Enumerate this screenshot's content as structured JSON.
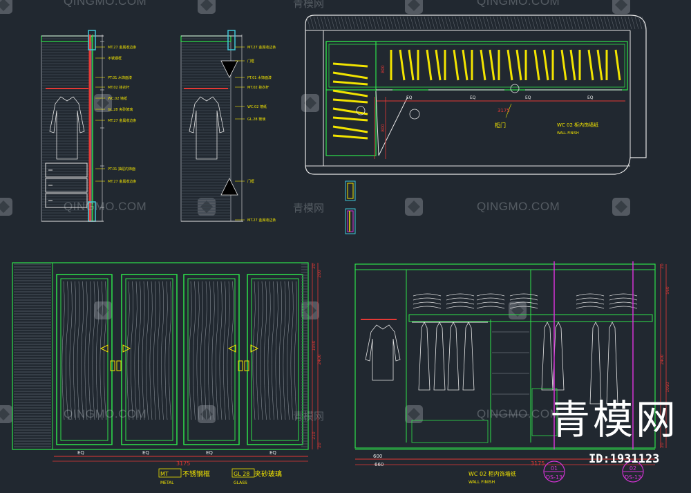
{
  "watermark": {
    "latin": "QINGMO.COM",
    "chinese": "青模网"
  },
  "brand": {
    "big_text": "青模网",
    "id_text": "ID:1931123"
  },
  "plan": {
    "door_label": "柜门",
    "wall_code": "WC 02 柜内饰墙纸",
    "wall_finish": "WALL FINISH",
    "dim_top": "3175",
    "eq": [
      "EQ",
      "EQ",
      "EQ",
      "EQ"
    ],
    "side_dims": [
      "800",
      "800"
    ]
  },
  "section_left": {
    "tags": [
      "MT.27 金属收边条",
      "不锈钢框",
      "PT.01 木饰面漆",
      "MT.02 挂衣杆",
      "WC.02 墙纸",
      "GL.28 夹砂玻璃",
      "MT.27 金属收边条",
      "PT.01 抽屉内饰面",
      "MT.27 金属收边条"
    ]
  },
  "section_right": {
    "tags": [
      "MT.27 金属收边条",
      "门框",
      "PT.01 木饰面漆",
      "MT.02 挂衣杆",
      "WC.02 墙纸",
      "GL.28 玻璃",
      "门框",
      "MT.27 金属收边条"
    ]
  },
  "elevation_front": {
    "dim_total": "3175",
    "eq": [
      "EQ",
      "EQ",
      "EQ",
      "EQ"
    ],
    "right_dims": [
      "20",
      "200",
      "1950",
      "2400",
      "210",
      "20"
    ],
    "legend_mt_code": "MT",
    "legend_mt_cn": "不锈钢框",
    "legend_mt_en": "METAL",
    "legend_gl_code": "GL 28",
    "legend_gl_cn": "夹砂玻璃",
    "legend_gl_en": "GLASS"
  },
  "elevation_interior": {
    "dim_total": "3175",
    "bottom_dims": [
      "600",
      "660"
    ],
    "right_dims": [
      "20",
      "560",
      "2400",
      "1050",
      "20"
    ],
    "wall_code": "WC 02 柜内饰墙纸",
    "wall_finish": "WALL FINISH",
    "callouts": [
      {
        "num": "01",
        "sheet": "DS-13"
      },
      {
        "num": "02",
        "sheet": "DS-13"
      }
    ]
  }
}
